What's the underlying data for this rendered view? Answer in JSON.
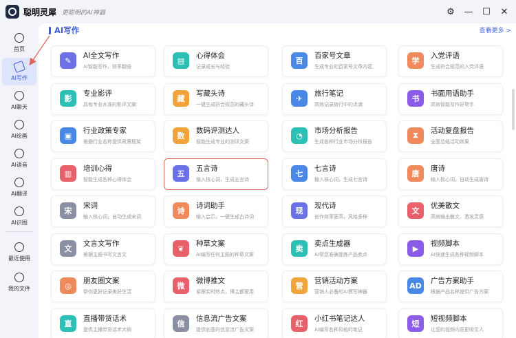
{
  "app": {
    "name": "聪明灵犀",
    "slogan": "更聪明的AI神器"
  },
  "window_controls": [
    {
      "name": "settings-icon",
      "glyph": "⚙"
    },
    {
      "name": "minimize-icon",
      "glyph": "—"
    },
    {
      "name": "maximize-icon",
      "glyph": "☐"
    },
    {
      "name": "close-icon",
      "glyph": "✕"
    }
  ],
  "sidebar": {
    "items": [
      {
        "label": "首页",
        "icon": "home-icon",
        "active": false
      },
      {
        "label": "AI写作",
        "icon": "pen-icon",
        "active": true
      },
      {
        "label": "AI聊天",
        "icon": "chat-icon",
        "active": false
      },
      {
        "label": "AI绘画",
        "icon": "brush-icon",
        "active": false
      },
      {
        "label": "AI语音",
        "icon": "headset-icon",
        "active": false
      },
      {
        "label": "AI翻译",
        "icon": "translate-icon",
        "active": false
      },
      {
        "label": "AI识图",
        "icon": "scan-icon",
        "active": false
      },
      {
        "label": "最近使用",
        "icon": "clock-icon",
        "active": false
      },
      {
        "label": "我的文件",
        "icon": "file-icon",
        "active": false
      }
    ]
  },
  "section": {
    "title": "AI写作",
    "view_more": "查看更多 >"
  },
  "cards": [
    {
      "title": "AI全文写作",
      "desc": "AI智能写作，效率翻倍",
      "icon": "ai-write-icon",
      "glyph": "✎",
      "color": "#6b72e8"
    },
    {
      "title": "心得体会",
      "desc": "记录成长与经验",
      "icon": "notebook-icon",
      "glyph": "▤",
      "color": "#2bbfb5"
    },
    {
      "title": "百家号文章",
      "desc": "生成专业的百家号文章内容",
      "icon": "baijia-icon",
      "glyph": "百",
      "color": "#4a88e8"
    },
    {
      "title": "入党评语",
      "desc": "生成符合规范的入党评语",
      "icon": "party-icon",
      "glyph": "学",
      "color": "#f08a5d"
    },
    {
      "title": "专业影评",
      "desc": "具有专业水准的影评文案",
      "icon": "film-icon",
      "glyph": "影",
      "color": "#2bbfb5"
    },
    {
      "title": "写藏头诗",
      "desc": "一键生成符合规范的藏头诗",
      "icon": "acrostic-icon",
      "glyph": "藏",
      "color": "#f2a33a"
    },
    {
      "title": "旅行笔记",
      "desc": "高效记录旅行中的点滴",
      "icon": "travel-icon",
      "glyph": "✈",
      "color": "#4a88e8"
    },
    {
      "title": "书面用语助手",
      "desc": "高效智能写作好帮手",
      "icon": "book-icon",
      "glyph": "书",
      "color": "#8a5ce8"
    },
    {
      "title": "行业政策专家",
      "desc": "根据行业名称提供政策框架",
      "icon": "policy-icon",
      "glyph": "▣",
      "color": "#4a88e8"
    },
    {
      "title": "数码评测达人",
      "desc": "智能生成专业的测评文案",
      "icon": "digital-icon",
      "glyph": "数",
      "color": "#f2a33a"
    },
    {
      "title": "市场分析报告",
      "desc": "生成各种行业市场分析报告",
      "icon": "pie-chart-icon",
      "glyph": "◔",
      "color": "#2bbfb5"
    },
    {
      "title": "活动复盘报告",
      "desc": "全面总结活动效果",
      "icon": "hourglass-icon",
      "glyph": "⧗",
      "color": "#f08a5d"
    },
    {
      "title": "培训心得",
      "desc": "智能生成各种心得体会",
      "icon": "training-icon",
      "glyph": "▥",
      "color": "#e8606a"
    },
    {
      "title": "五言诗",
      "desc": "输入核心词，生成五言诗",
      "icon": "poem5-icon",
      "glyph": "五",
      "color": "#6b72e8"
    },
    {
      "title": "七言诗",
      "desc": "输入核心词，生成七言诗",
      "icon": "poem7-icon",
      "glyph": "七",
      "color": "#4a88e8"
    },
    {
      "title": "唐诗",
      "desc": "输入核心词，自动生成唐诗",
      "icon": "tang-poem-icon",
      "glyph": "唐",
      "color": "#f08a5d"
    },
    {
      "title": "宋词",
      "desc": "输入核心词，自动生成宋词",
      "icon": "song-ci-icon",
      "glyph": "宋",
      "color": "#8a8fa3"
    },
    {
      "title": "诗词助手",
      "desc": "输入启示，一键生成古诗词",
      "icon": "poetry-helper-icon",
      "glyph": "诗",
      "color": "#f08a5d"
    },
    {
      "title": "现代诗",
      "desc": "创作效率更高，风格多样",
      "icon": "modern-poem-icon",
      "glyph": "现",
      "color": "#6b72e8"
    },
    {
      "title": "优美散文",
      "desc": "高效输出散文，激发灵感",
      "icon": "prose-icon",
      "glyph": "文",
      "color": "#e8606a"
    },
    {
      "title": "文言文写作",
      "desc": "根据主题书写文言文",
      "icon": "classical-icon",
      "glyph": "文",
      "color": "#8a8fa3"
    },
    {
      "title": "种草文案",
      "desc": "AI编写任何主题的种草文案",
      "icon": "sprout-icon",
      "glyph": "❦",
      "color": "#e8606a"
    },
    {
      "title": "卖点生成器",
      "desc": "AI帮您准确提炼产品卖点",
      "icon": "selling-point-icon",
      "glyph": "卖",
      "color": "#2bbfb5"
    },
    {
      "title": "视频脚本",
      "desc": "AI快速生成各种视频脚本",
      "icon": "video-script-icon",
      "glyph": "▶",
      "color": "#8a5ce8"
    },
    {
      "title": "朋友圈文案",
      "desc": "帮你更好记录美好生活",
      "icon": "moments-icon",
      "glyph": "◎",
      "color": "#f08a5d"
    },
    {
      "title": "微博推文",
      "desc": "紧跟实时热点，博主都爱用",
      "icon": "weibo-icon",
      "glyph": "微",
      "color": "#e8606a"
    },
    {
      "title": "营销活动方案",
      "desc": "营销人必备的AI撰写神器",
      "icon": "marketing-icon",
      "glyph": "营",
      "color": "#f2a33a"
    },
    {
      "title": "广告方案助手",
      "desc": "根据产品名称提供广告方案",
      "icon": "ad-icon",
      "glyph": "AD",
      "color": "#4a88e8"
    },
    {
      "title": "直播带货话术",
      "desc": "提供主播带货话术大纲",
      "icon": "live-icon",
      "glyph": "直",
      "color": "#2bbfb5"
    },
    {
      "title": "信息流广告文案",
      "desc": "提供创意的信息流广告文案",
      "icon": "feed-ad-icon",
      "glyph": "信",
      "color": "#8a8fa3"
    },
    {
      "title": "小红书笔记达人",
      "desc": "AI编写各种风格的笔记",
      "icon": "redbook-icon",
      "glyph": "红",
      "color": "#e8606a"
    },
    {
      "title": "短视频脚本",
      "desc": "让您的视频内容更吸引人",
      "icon": "short-video-icon",
      "glyph": "短",
      "color": "#8a5ce8"
    }
  ]
}
